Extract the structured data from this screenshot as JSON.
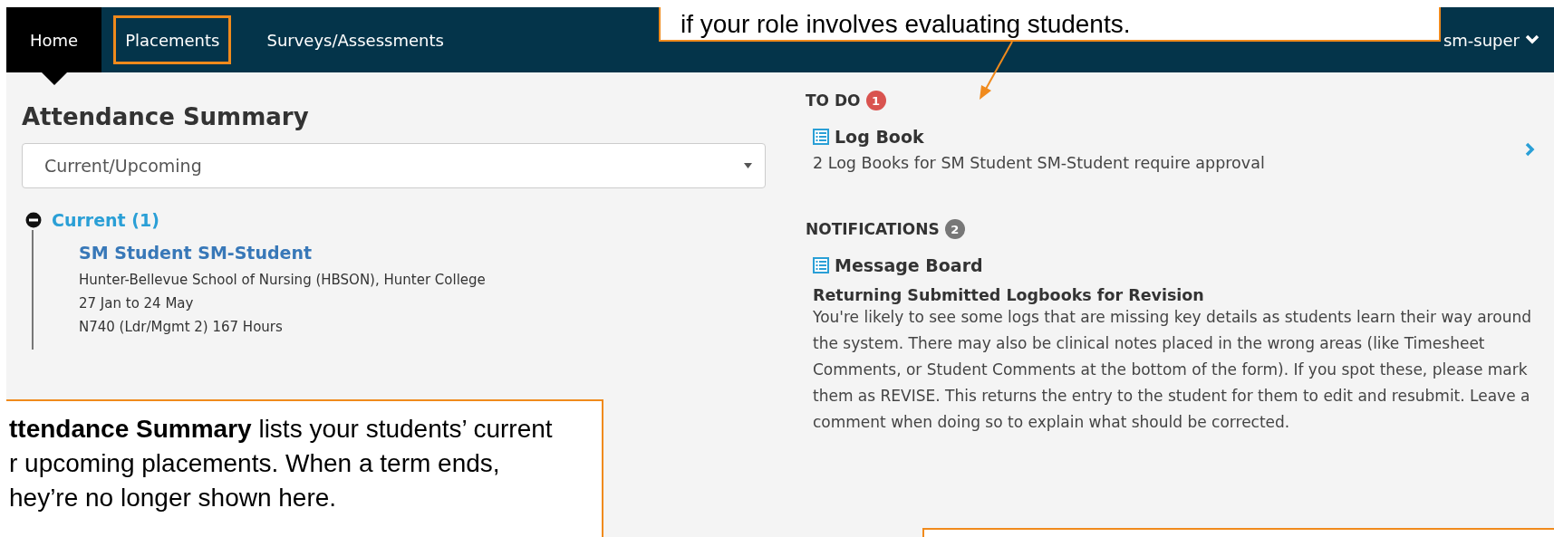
{
  "nav": {
    "tabs": [
      {
        "label": "Home",
        "selected": true,
        "highlighted": false
      },
      {
        "label": "Placements",
        "selected": false,
        "highlighted": true
      },
      {
        "label": "Surveys/Assessments",
        "selected": false,
        "highlighted": false
      }
    ],
    "user_menu": "sm-super"
  },
  "attendance": {
    "title": "Attendance Summary",
    "filter": "Current/Upcoming",
    "groups": [
      {
        "label": "Current (1)",
        "expanded": true,
        "children": [
          {
            "name": "SM Student SM-Student",
            "school": "Hunter-Bellevue School of Nursing (HBSON), Hunter College",
            "dates": "27 Jan to 24 May",
            "course": "N740 (Ldr/Mgmt 2) 167 Hours"
          }
        ]
      }
    ]
  },
  "todo": {
    "title": "TO DO",
    "count": {
      "text": "1",
      "color": "#d9534f"
    },
    "items": [
      {
        "title": "Log Book",
        "text": "2 Log Books for SM Student SM-Student require approval"
      }
    ]
  },
  "notifications": {
    "title": "NOTIFICATIONS",
    "count": {
      "text": "2",
      "color": "#777777"
    },
    "items": [
      {
        "title": "Message Board",
        "subject": "Returning Submitted Logbooks for Revision",
        "body": "You're likely to see some logs that are missing key details as students learn their way around the system. There may also be clinical notes placed in the wrong areas (like Timesheet Comments, or Student Comments at the bottom of the form). If you spot these, please mark them as REVISE. This returns the entry to the student for them to edit and resubmit. Leave a comment when doing so to explain what should be corrected."
      }
    ]
  },
  "callouts": [
    {
      "kind": "top",
      "arrow": true,
      "lines": [
        "if your role involves evaluating students."
      ]
    },
    {
      "kind": "left",
      "lines": [
        "**ttendance Summary** lists your students’ current",
        "r upcoming placements. When a term ends,",
        "hey’re no longer shown here."
      ]
    },
    {
      "kind": "bottom"
    }
  ]
}
